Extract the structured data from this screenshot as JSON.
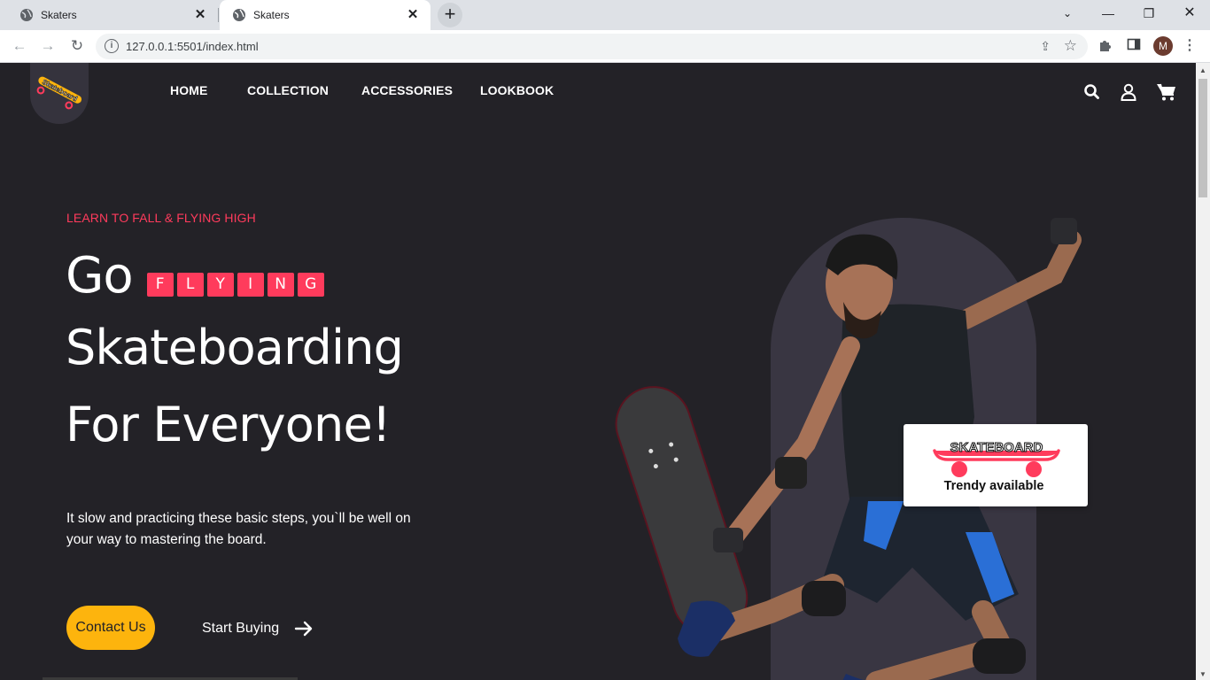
{
  "browser": {
    "tabs": [
      {
        "title": "Skaters",
        "active": false
      },
      {
        "title": "Skaters",
        "active": true
      }
    ],
    "url": "127.0.0.1:5501/index.html",
    "profile_initial": "M"
  },
  "site": {
    "logo_text": "Skateboard",
    "nav": [
      "HOME",
      "COLLECTION",
      "ACCESSORIES",
      "LOOKBOOK"
    ],
    "header_icons": [
      "search-icon",
      "user-icon",
      "cart-icon"
    ]
  },
  "hero": {
    "eyebrow": "LEARN TO FALL & FLYING HIGH",
    "go_word": "Go",
    "flying_letters": [
      "F",
      "L",
      "Y",
      "I",
      "N",
      "G"
    ],
    "line2": "Skateboarding",
    "line3": "For Everyone!",
    "description": "It slow and practicing these basic steps, you`ll be well on your way to mastering the board.",
    "primary_button": "Contact Us",
    "secondary_button": "Start Buying"
  },
  "promo_card": {
    "art_text": "SKATEBOARD",
    "caption": "Trendy available"
  },
  "colors": {
    "background": "#232227",
    "accent_pink": "#ff3b5c",
    "accent_yellow": "#fdb40d",
    "arch": "#393642"
  }
}
